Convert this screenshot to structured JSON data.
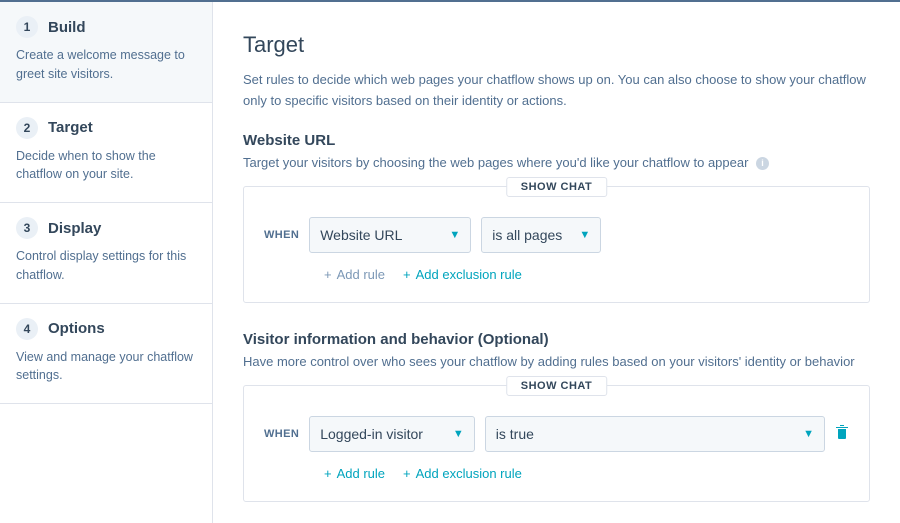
{
  "sidebar": {
    "steps": [
      {
        "num": "1",
        "title": "Build",
        "desc": "Create a welcome message to greet site visitors."
      },
      {
        "num": "2",
        "title": "Target",
        "desc": "Decide when to show the chatflow on your site."
      },
      {
        "num": "3",
        "title": "Display",
        "desc": "Control display settings for this chatflow."
      },
      {
        "num": "4",
        "title": "Options",
        "desc": "View and manage your chatflow settings."
      }
    ]
  },
  "main": {
    "title": "Target",
    "desc": "Set rules to decide which web pages your chatflow shows up on. You can also choose to show your chatflow only to specific visitors based on their identity or actions.",
    "url_section": {
      "heading": "Website URL",
      "sub": "Target your visitors by choosing the web pages where you'd like your chatflow to appear",
      "box_label": "SHOW CHAT",
      "when": "WHEN",
      "select1": "Website URL",
      "select2": "is all pages",
      "add_rule": "Add rule",
      "add_exclusion": "Add exclusion rule"
    },
    "visitor_section": {
      "heading": "Visitor information and behavior (Optional)",
      "sub": "Have more control over who sees your chatflow by adding rules based on your visitors' identity or behavior",
      "box_label": "SHOW CHAT",
      "when": "WHEN",
      "select1": "Logged-in visitor",
      "select2": "is true",
      "add_rule": "Add rule",
      "add_exclusion": "Add exclusion rule"
    }
  }
}
